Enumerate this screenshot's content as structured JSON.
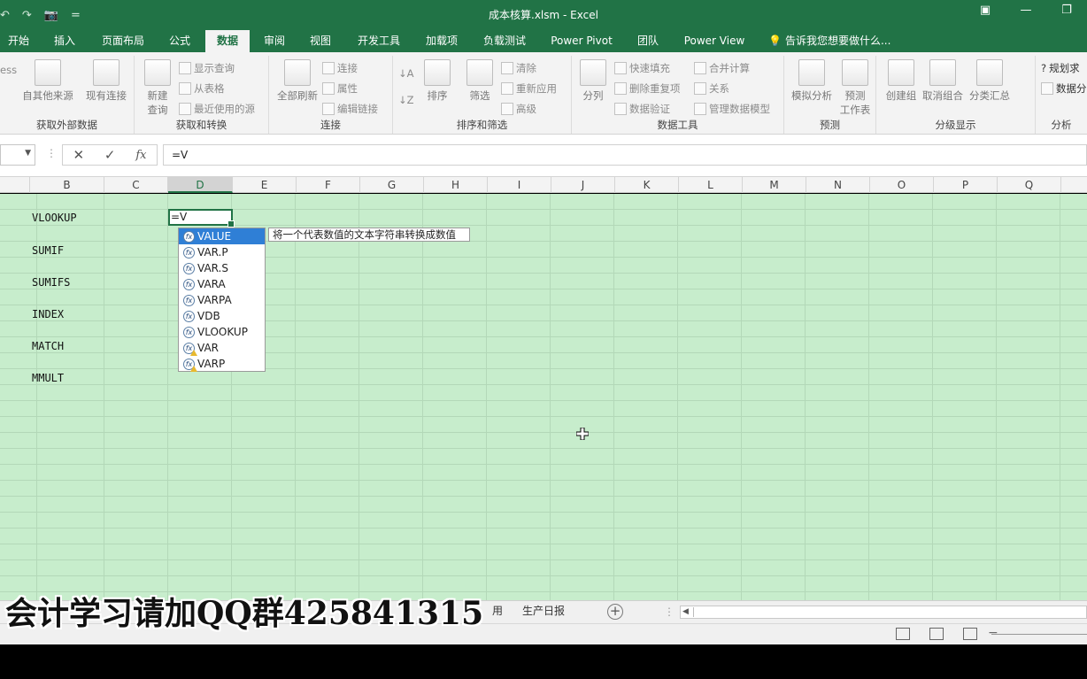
{
  "window": {
    "title": "成本核算.xlsm - Excel",
    "quick_access": [
      "↶",
      "↷",
      "📷",
      "="
    ]
  },
  "tabs": [
    "开始",
    "插入",
    "页面布局",
    "公式",
    "数据",
    "审阅",
    "视图",
    "开发工具",
    "加载项",
    "负载测试",
    "Power Pivot",
    "团队",
    "Power View"
  ],
  "active_tab": "数据",
  "tell_me": "告诉我您想要做什么...",
  "ribbon": {
    "groups": {
      "external": "获取外部数据",
      "transform": "获取和转换",
      "connections": "连接",
      "sort_filter": "排序和筛选",
      "data_tools": "数据工具",
      "forecast": "预测",
      "outline": "分级显示",
      "analysis": "分析"
    },
    "buttons": {
      "access": "ess",
      "from_other": "自其他来源",
      "existing": "现有连接",
      "new_query_1": "新建",
      "new_query_2": "查询",
      "show_query": "显示查询",
      "from_table": "从表格",
      "recent_sources": "最近使用的源",
      "refresh_all": "全部刷新",
      "connections": "连接",
      "properties": "属性",
      "edit_links": "编辑链接",
      "sort": "排序",
      "filter": "筛选",
      "clear": "清除",
      "reapply": "重新应用",
      "advanced": "高级",
      "text_to_cols": "分列",
      "flash_fill": "快速填充",
      "remove_dup": "删除重复项",
      "validation": "数据验证",
      "consolidate": "合并计算",
      "relationships": "关系",
      "data_model": "管理数据模型",
      "what_if": "模拟分析",
      "forecast_sheet_1": "预测",
      "forecast_sheet_2": "工作表",
      "group": "创建组",
      "ungroup": "取消组合",
      "subtotal": "分类汇总",
      "solver": "规划求",
      "data_analysis": "数据分"
    }
  },
  "formula_bar": {
    "cancel": "✕",
    "enter": "✓",
    "fx": "fx",
    "value": "=V"
  },
  "columns": [
    "B",
    "C",
    "D",
    "E",
    "F",
    "G",
    "H",
    "I",
    "J",
    "K",
    "L",
    "M",
    "N",
    "O",
    "P",
    "Q"
  ],
  "selected_column": "D",
  "cells": {
    "b2": "VLOOKUP",
    "b4": "SUMIF",
    "b6": "SUMIFS",
    "b8": "INDEX",
    "b10": "MATCH",
    "b12": "MMULT",
    "d2": "=V"
  },
  "autocomplete": {
    "items": [
      {
        "label": "VALUE",
        "selected": true,
        "warning": false
      },
      {
        "label": "VAR.P",
        "selected": false,
        "warning": false
      },
      {
        "label": "VAR.S",
        "selected": false,
        "warning": false
      },
      {
        "label": "VARA",
        "selected": false,
        "warning": false
      },
      {
        "label": "VARPA",
        "selected": false,
        "warning": false
      },
      {
        "label": "VDB",
        "selected": false,
        "warning": false
      },
      {
        "label": "VLOOKUP",
        "selected": false,
        "warning": false
      },
      {
        "label": "VAR",
        "selected": false,
        "warning": true
      },
      {
        "label": "VARP",
        "selected": false,
        "warning": true
      }
    ],
    "tooltip": "将一个代表数值的文本字符串转换成数值"
  },
  "sheet_tabs": {
    "partial": "用",
    "daily_report": "生产日报",
    "add": "+"
  },
  "watermark": "会计学习请加QQ群425841315",
  "colors": {
    "excel_green": "#217346",
    "grid_bg": "#c7edcc",
    "selection_blue": "#2f7fd6"
  }
}
